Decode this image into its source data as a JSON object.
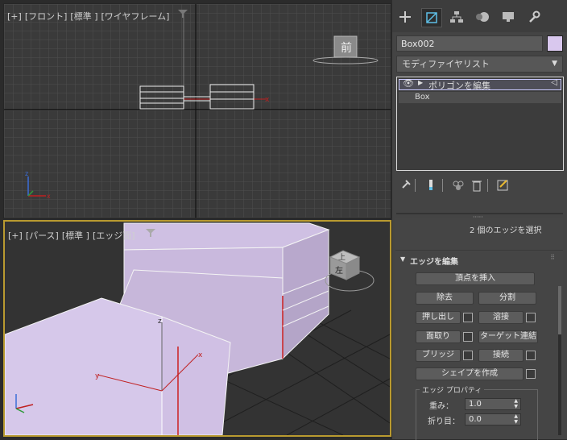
{
  "viewport_front": {
    "label_parts": [
      "[+]",
      "[フロント]",
      "[標準 ]",
      "[ワイヤフレーム]"
    ],
    "viewcube_face": "前"
  },
  "viewport_persp": {
    "label_parts": [
      "[+]",
      "[パース]",
      "[標準 ]",
      "[エッジ面]"
    ],
    "viewcube_faces": [
      "上",
      "左"
    ]
  },
  "command_panel": {
    "tabs": [
      "create-icon",
      "modify-icon",
      "hierarchy-icon",
      "motion-icon",
      "display-icon",
      "utilities-icon"
    ],
    "object_name": "Box002",
    "object_color": "#d9c8ee",
    "modifier_list": "モディファイヤリスト",
    "stack": [
      "ポリゴンを編集",
      "Box"
    ],
    "selection_info": "2 個のエッジを選択",
    "rollout_title": "エッジを編集",
    "buttons": {
      "insert_vertex": "頂点を挿入",
      "remove": "除去",
      "split": "分割",
      "extrude": "押し出し",
      "weld": "溶接",
      "chamfer": "面取り",
      "target_weld": "ターゲット連結",
      "bridge": "ブリッジ",
      "connect": "接続",
      "create_shape": "シェイプを作成"
    },
    "edge_properties": {
      "title": "エッジ プロパティ",
      "weight_label": "重み：",
      "weight_value": "1.0",
      "crease_label": "折り目：",
      "crease_value": "0.0"
    }
  }
}
